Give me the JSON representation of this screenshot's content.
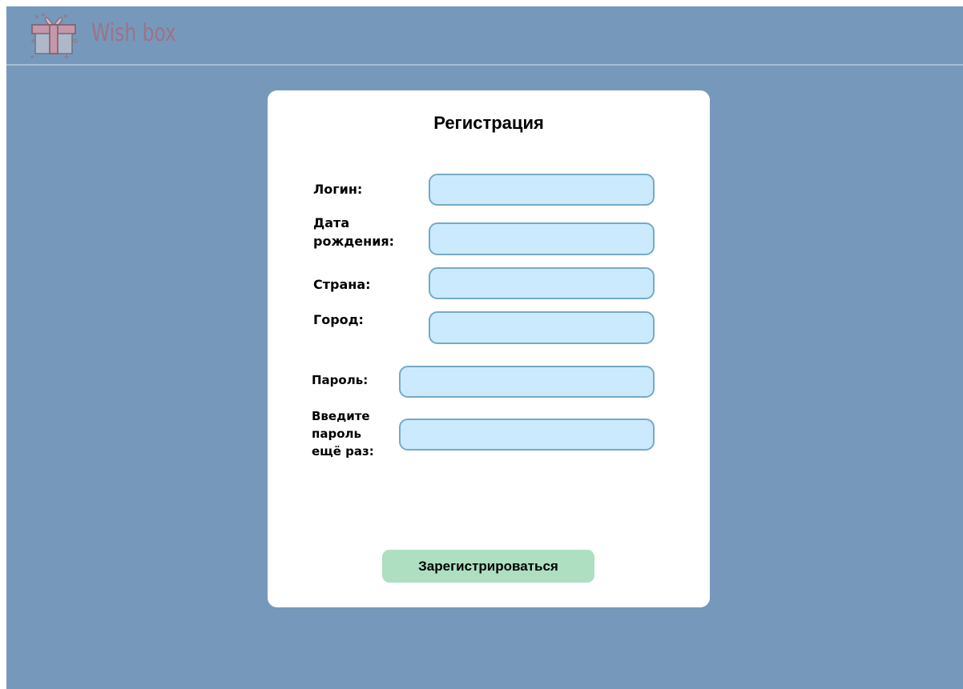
{
  "header": {
    "logo_text": "Wish box",
    "logo_icon": "gift-icon"
  },
  "form": {
    "title": "Регистрация",
    "fields": {
      "login": {
        "label": "Логин:",
        "value": "",
        "placeholder": ""
      },
      "birthdate": {
        "label_line1": "Дата",
        "label_line2": "рождения:",
        "value": "",
        "placeholder": ""
      },
      "country": {
        "label": "Страна:",
        "value": "",
        "placeholder": ""
      },
      "city": {
        "label": "Город:",
        "value": "",
        "placeholder": ""
      },
      "password": {
        "label": "Пароль:",
        "value": "",
        "placeholder": ""
      },
      "password_repeat": {
        "label_line1": "Введите",
        "label_line2": "пароль",
        "label_line3": "ещё раз:",
        "value": "",
        "placeholder": ""
      }
    },
    "submit_label": "Зарегистрироваться"
  },
  "colors": {
    "background": "#7699bb",
    "card": "#ffffff",
    "input_fill": "#cbeafd",
    "input_border": "#75aac6",
    "button": "#addfc0",
    "logo_text": "#9e7288"
  }
}
